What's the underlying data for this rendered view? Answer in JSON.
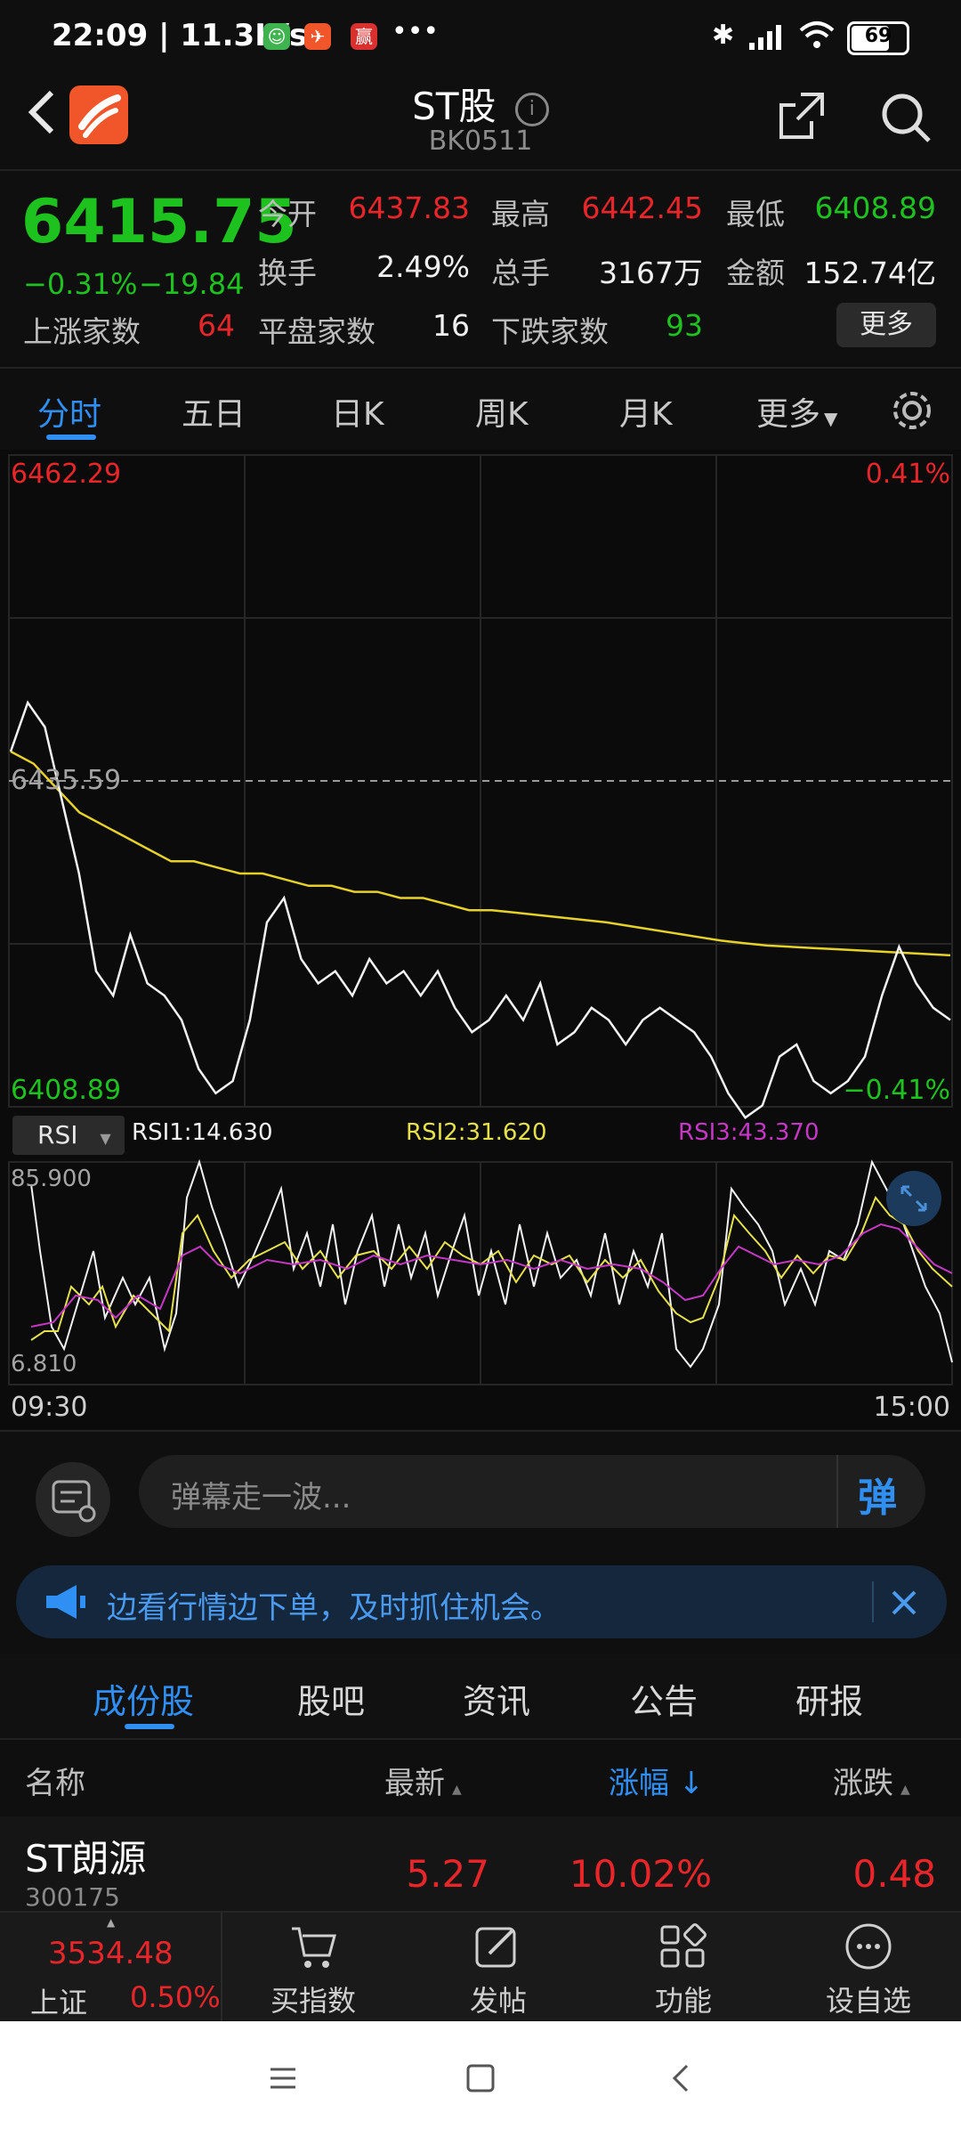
{
  "status_bar": {
    "time": "22:09 | 11.3K/s",
    "battery": "69"
  },
  "header": {
    "title": "ST股",
    "code": "BK0511"
  },
  "quote": {
    "price": "6415.75",
    "change_pct": "−0.31%",
    "change_val": "−19.84",
    "open_label": "今开",
    "open": "6437.83",
    "high_label": "最高",
    "high": "6442.45",
    "low_label": "最低",
    "low": "6408.89",
    "turnover_label": "换手",
    "turnover": "2.49%",
    "volume_label": "总手",
    "volume": "3167万",
    "amount_label": "金额",
    "amount": "152.74亿",
    "up_label": "上涨家数",
    "up": "64",
    "flat_label": "平盘家数",
    "flat": "16",
    "down_label": "下跌家数",
    "down": "93",
    "more_label": "更多"
  },
  "tabs": [
    "分时",
    "五日",
    "日K",
    "周K",
    "月K",
    "更多"
  ],
  "chart_labels": {
    "top_price": "6462.29",
    "top_pct": "0.41%",
    "mid_price": "6435.59",
    "bottom_price": "6408.89",
    "bottom_pct": "−0.41%",
    "rsi_select": "RSI",
    "rsi1": "RSI1:14.630",
    "rsi2": "RSI2:31.620",
    "rsi3": "RSI3:43.370",
    "rsi_top": "85.900",
    "rsi_bottom": "6.810",
    "time_start": "09:30",
    "time_end": "15:00"
  },
  "chart_data": {
    "type": "line",
    "title": "",
    "ylim": [
      6408.89,
      6462.29
    ],
    "reference": 6435.59,
    "series": [
      {
        "values": [
          6438,
          6442,
          6440,
          6434,
          6428,
          6420,
          6418,
          6423,
          6419,
          6418,
          6416,
          6412,
          6410,
          6411,
          6416,
          6424,
          6426,
          6421,
          6419,
          6420,
          6418,
          6421,
          6419,
          6420,
          6418,
          6420,
          6417,
          6415,
          6416,
          6418,
          6416,
          6419,
          6414,
          6415,
          6417,
          6416,
          6414,
          6416,
          6417,
          6416,
          6415,
          6413,
          6410,
          6408,
          6409,
          6413,
          6414,
          6411,
          6410,
          6411,
          6413,
          6418,
          6422,
          6419,
          6417,
          6416
        ]
      },
      {
        "values": [
          6438,
          6437,
          6435,
          6433,
          6432,
          6431,
          6430,
          6429,
          6429,
          6428.5,
          6428,
          6428,
          6427.5,
          6427,
          6427,
          6426.5,
          6426.5,
          6426,
          6426,
          6425.5,
          6425,
          6425,
          6424.8,
          6424.6,
          6424.4,
          6424.2,
          6424,
          6423.7,
          6423.4,
          6423.1,
          6422.8,
          6422.5,
          6422.3,
          6422.1,
          6422,
          6421.9,
          6421.8,
          6421.7,
          6421.6,
          6421.5,
          6421.4,
          6421.3
        ]
      }
    ]
  },
  "danmu": {
    "placeholder": "弹幕走一波...",
    "button": "弹"
  },
  "banner": {
    "text": "边看行情边下单，及时抓住机会。"
  },
  "sub_tabs": [
    "成份股",
    "股吧",
    "资讯",
    "公告",
    "研报"
  ],
  "table": {
    "headers": [
      "名称",
      "最新",
      "涨幅 ↓",
      "涨跌"
    ],
    "rows": [
      {
        "name": "ST朗源",
        "code": "300175",
        "price": "5.27",
        "pct": "10.02%",
        "change": "0.48"
      }
    ]
  },
  "bottom_nav": {
    "index_value": "3534.48",
    "index_name": "上证",
    "index_pct": "0.50%",
    "items": [
      "买指数",
      "发帖",
      "功能",
      "设自选"
    ]
  }
}
